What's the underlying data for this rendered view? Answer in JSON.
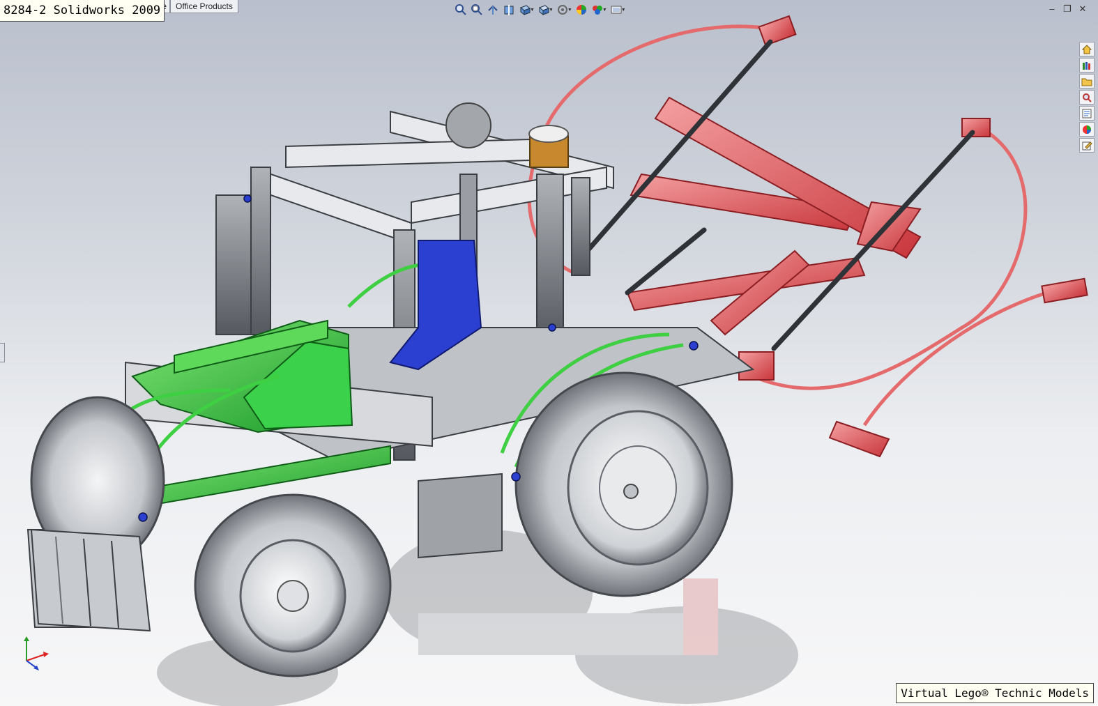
{
  "window": {
    "title_overlay": "8284-2 Solidworks 2009",
    "tabs": [
      {
        "label": "e"
      },
      {
        "label": "Office Products"
      }
    ]
  },
  "heads_up_toolbar": {
    "icons": [
      "zoom-to-fit-icon",
      "zoom-to-area-icon",
      "previous-view-icon",
      "section-view-icon",
      "view-orientation-icon",
      "display-style-icon",
      "hide-show-items-icon",
      "edit-appearance-icon",
      "apply-scene-icon",
      "view-settings-icon"
    ]
  },
  "task_pane": {
    "icons": [
      "solidworks-resources-icon",
      "design-library-icon",
      "file-explorer-icon",
      "search-icon",
      "view-palette-icon",
      "appearances-scenes-icon",
      "custom-properties-icon"
    ]
  },
  "watermark": "Virtual Lego® Technic Models",
  "colors": {
    "viewport_top": "#b9bfcc",
    "viewport_bottom": "#f7f7f8",
    "part_green": "#2fc83a",
    "part_red": "#e05a5e",
    "part_blue": "#2b3fd0",
    "part_grey": "#8c9096",
    "part_white": "#eef0f2",
    "part_gold": "#c8892e",
    "tire": "#c9ccd1"
  }
}
